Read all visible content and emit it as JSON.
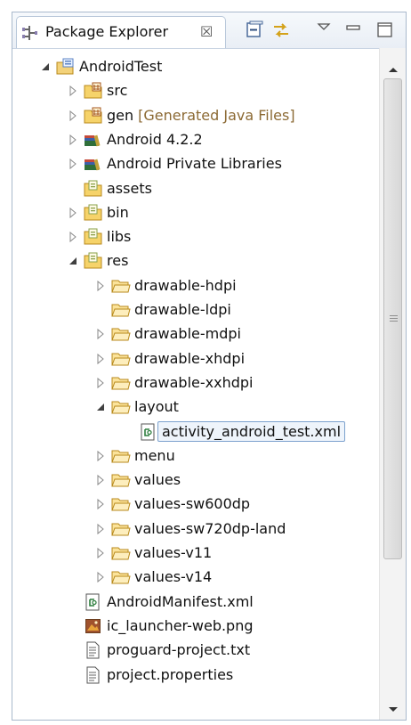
{
  "view": {
    "tab_title": "Package Explorer",
    "tab_close_glyph": "☒",
    "tab_icon": "package-explorer-icon",
    "toolbar": [
      "collapse-all-icon",
      "link-with-editor-icon",
      "view-menu-icon",
      "minimize-icon",
      "maximize-icon"
    ]
  },
  "tree": {
    "items": [
      {
        "label": "AndroidTest",
        "decoration": "",
        "depth": 0,
        "expander": "expanded",
        "icon": "project-icon",
        "selected": false
      },
      {
        "label": "src",
        "decoration": "",
        "depth": 1,
        "expander": "collapsed",
        "icon": "source-folder-icon",
        "selected": false
      },
      {
        "label": "gen",
        "decoration": "[Generated Java Files]",
        "depth": 1,
        "expander": "collapsed",
        "icon": "source-folder-icon",
        "selected": false
      },
      {
        "label": "Android 4.2.2",
        "decoration": "",
        "depth": 1,
        "expander": "collapsed",
        "icon": "library-icon",
        "selected": false
      },
      {
        "label": "Android Private Libraries",
        "decoration": "",
        "depth": 1,
        "expander": "collapsed",
        "icon": "library-icon",
        "selected": false
      },
      {
        "label": "assets",
        "decoration": "",
        "depth": 1,
        "expander": "none",
        "icon": "package-folder-icon",
        "selected": false
      },
      {
        "label": "bin",
        "decoration": "",
        "depth": 1,
        "expander": "collapsed",
        "icon": "package-folder-icon",
        "selected": false
      },
      {
        "label": "libs",
        "decoration": "",
        "depth": 1,
        "expander": "collapsed",
        "icon": "package-folder-icon",
        "selected": false
      },
      {
        "label": "res",
        "decoration": "",
        "depth": 1,
        "expander": "expanded",
        "icon": "package-folder-icon",
        "selected": false
      },
      {
        "label": "drawable-hdpi",
        "decoration": "",
        "depth": 2,
        "expander": "collapsed",
        "icon": "folder-icon",
        "selected": false
      },
      {
        "label": "drawable-ldpi",
        "decoration": "",
        "depth": 2,
        "expander": "none",
        "icon": "folder-icon",
        "selected": false
      },
      {
        "label": "drawable-mdpi",
        "decoration": "",
        "depth": 2,
        "expander": "collapsed",
        "icon": "folder-icon",
        "selected": false
      },
      {
        "label": "drawable-xhdpi",
        "decoration": "",
        "depth": 2,
        "expander": "collapsed",
        "icon": "folder-icon",
        "selected": false
      },
      {
        "label": "drawable-xxhdpi",
        "decoration": "",
        "depth": 2,
        "expander": "collapsed",
        "icon": "folder-icon",
        "selected": false
      },
      {
        "label": "layout",
        "decoration": "",
        "depth": 2,
        "expander": "expanded",
        "icon": "folder-icon",
        "selected": false
      },
      {
        "label": "activity_android_test.xml",
        "decoration": "",
        "depth": 3,
        "expander": "none",
        "icon": "xml-file-icon",
        "selected": true
      },
      {
        "label": "menu",
        "decoration": "",
        "depth": 2,
        "expander": "collapsed",
        "icon": "folder-icon",
        "selected": false
      },
      {
        "label": "values",
        "decoration": "",
        "depth": 2,
        "expander": "collapsed",
        "icon": "folder-icon",
        "selected": false
      },
      {
        "label": "values-sw600dp",
        "decoration": "",
        "depth": 2,
        "expander": "collapsed",
        "icon": "folder-icon",
        "selected": false
      },
      {
        "label": "values-sw720dp-land",
        "decoration": "",
        "depth": 2,
        "expander": "collapsed",
        "icon": "folder-icon",
        "selected": false
      },
      {
        "label": "values-v11",
        "decoration": "",
        "depth": 2,
        "expander": "collapsed",
        "icon": "folder-icon",
        "selected": false
      },
      {
        "label": "values-v14",
        "decoration": "",
        "depth": 2,
        "expander": "collapsed",
        "icon": "folder-icon",
        "selected": false
      },
      {
        "label": "AndroidManifest.xml",
        "decoration": "",
        "depth": 1,
        "expander": "none",
        "icon": "xml-file-icon",
        "selected": false
      },
      {
        "label": "ic_launcher-web.png",
        "decoration": "",
        "depth": 1,
        "expander": "none",
        "icon": "image-file-icon",
        "selected": false
      },
      {
        "label": "proguard-project.txt",
        "decoration": "",
        "depth": 1,
        "expander": "none",
        "icon": "text-file-icon",
        "selected": false
      },
      {
        "label": "project.properties",
        "decoration": "",
        "depth": 1,
        "expander": "none",
        "icon": "text-file-icon",
        "selected": false
      }
    ]
  },
  "scrollbar": {
    "position_fraction": 0.0,
    "visible_fraction": 0.73
  },
  "colors": {
    "selection_border": "#7da2ce",
    "selection_fill": "#eef4fb",
    "decoration_text": "#8c6a34",
    "view_border": "#a9b9cc"
  }
}
